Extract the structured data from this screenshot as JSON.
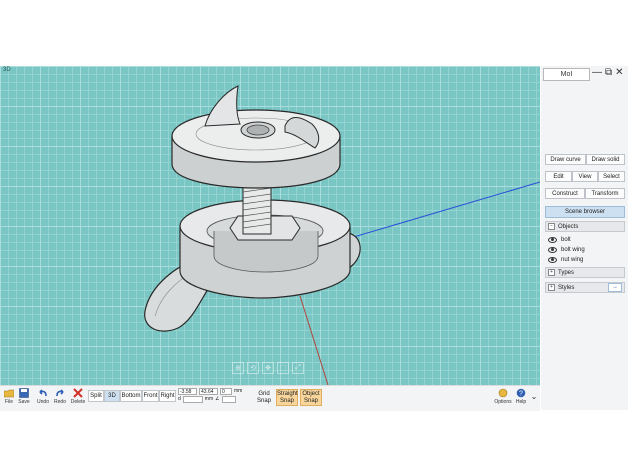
{
  "viewport": {
    "label": "3D"
  },
  "panel": {
    "title": "MoI",
    "window_buttons": {
      "minimize": "—",
      "restore": "⧉",
      "close": "✕"
    },
    "draw_curve": "Draw curve",
    "draw_solid": "Draw solid",
    "edit": "Edit",
    "view": "View",
    "select": "Select",
    "construct": "Construct",
    "transform": "Transform",
    "scene_browser": "Scene browser",
    "objects_header": "Objects",
    "objects": [
      "bolt",
      "bolt wing",
      "nut wing"
    ],
    "types_header": "Types",
    "styles_header": "Styles",
    "styles_arrow": "→"
  },
  "toolbar": {
    "file": "File",
    "save": "Save",
    "undo": "Undo",
    "redo": "Redo",
    "delete": "Delete",
    "views": [
      "Split",
      "3D",
      "Bottom",
      "Front",
      "Right"
    ],
    "active_view": "3D",
    "coord_x": "-3.58",
    "coord_y": "43.64",
    "coord_z": "0",
    "unit": "mm",
    "dist_label": "d",
    "dist_unit": "mm",
    "angle_label": "∠",
    "grid_snap": "Grid Snap",
    "straight_snap": "Straight Snap",
    "object_snap": "Object Snap",
    "options": "Options",
    "help": "Help"
  },
  "colors": {
    "accent": "#cde0f2",
    "snap_on": "#f8d59a",
    "viewport_bg": "#79c6c4"
  }
}
